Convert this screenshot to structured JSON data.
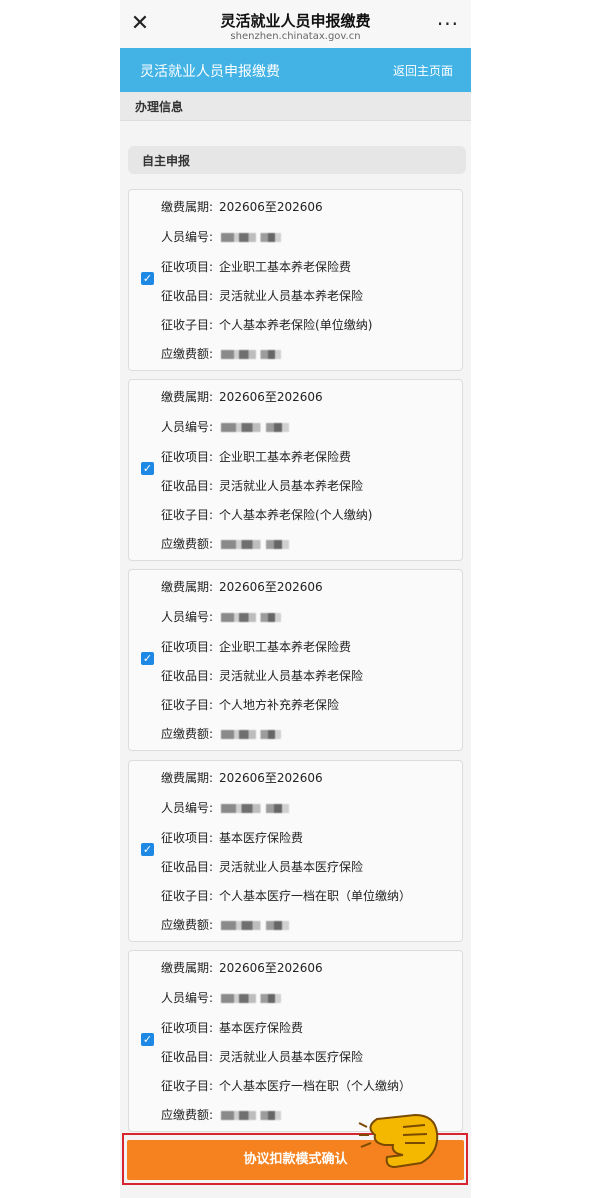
{
  "topbar": {
    "title": "灵活就业人员申报缴费",
    "url": "shenzhen.chinatax.gov.cn",
    "close_icon": "✕",
    "more_icon": "···"
  },
  "blue_header": {
    "title": "灵活就业人员申报缴费",
    "home_link": "返回主页面"
  },
  "section": {
    "title": "办理信息"
  },
  "tab": {
    "title": "自主申报"
  },
  "labels": {
    "period": "缴费属期:",
    "person_id": "人员编号:",
    "item": "征收项目:",
    "category": "征收品目:",
    "subitem": "征收子目:",
    "amount": "应缴费额:"
  },
  "records": [
    {
      "checked": true,
      "period": "202606至202606",
      "item": "企业职工基本养老保险费",
      "category": "灵活就业人员基本养老保险",
      "subitem": "个人基本养老保险(单位缴纳)"
    },
    {
      "checked": true,
      "period": "202606至202606",
      "item": "企业职工基本养老保险费",
      "category": "灵活就业人员基本养老保险",
      "subitem": "个人基本养老保险(个人缴纳)"
    },
    {
      "checked": true,
      "period": "202606至202606",
      "item": "企业职工基本养老保险费",
      "category": "灵活就业人员基本养老保险",
      "subitem": "个人地方补充养老保险"
    },
    {
      "checked": true,
      "period": "202606至202606",
      "item": "基本医疗保险费",
      "category": "灵活就业人员基本医疗保险",
      "subitem": "个人基本医疗一档在职（单位缴纳）"
    },
    {
      "checked": true,
      "period": "202606至202606",
      "item": "基本医疗保险费",
      "category": "灵活就业人员基本医疗保险",
      "subitem": "个人基本医疗一档在职（个人缴纳）"
    }
  ],
  "footer": {
    "confirm_button": "协议扣款模式确认"
  },
  "colors": {
    "accent_blue": "#43b3e6",
    "button_orange": "#f5821f",
    "highlight_red": "#d6252f",
    "checkbox_blue": "#1e88e5"
  },
  "icons": {
    "checkbox": "checkbox-checked-icon",
    "pointer": "pointing-hand-icon"
  }
}
